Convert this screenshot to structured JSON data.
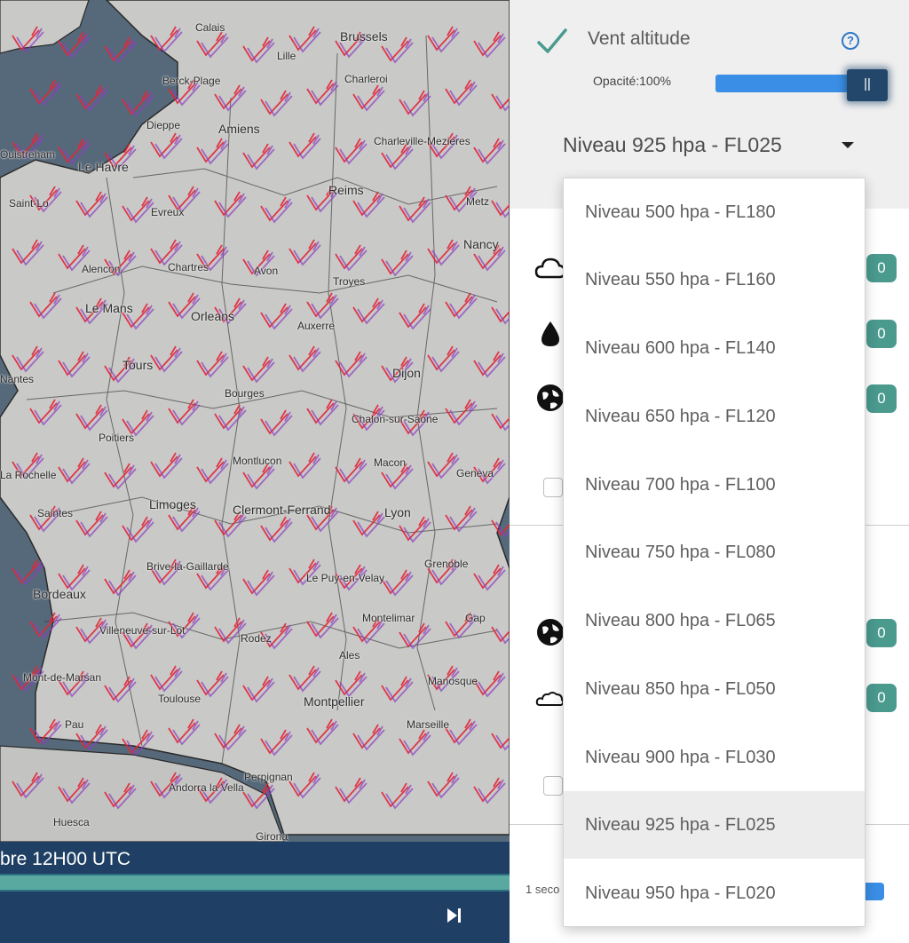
{
  "map": {
    "cities": [
      "Brussels",
      "Charleroi",
      "Calais",
      "Berck-Plage",
      "Lille",
      "Amiens",
      "Dieppe",
      "Le Havre",
      "Charleville-Mezieres",
      "Reims",
      "Evreux",
      "Metz",
      "Nancy",
      "Saint-Lo",
      "Alencon",
      "Chartres",
      "Avon",
      "Troyes",
      "Le Mans",
      "Orleans",
      "Auxerre",
      "Tours",
      "Dijon",
      "Bourges",
      "Chalon-sur-Saone",
      "Poitiers",
      "Montlucon",
      "Macon",
      "Limoges",
      "Clermont-Ferrand",
      "Lyon",
      "Saintes",
      "Geneva",
      "Grenoble",
      "Brive-la-Gaillarde",
      "Le Puy-en-Velay",
      "Bordeaux",
      "Montelimar",
      "Gap",
      "Villeneuve-sur-Lot",
      "Rodez",
      "Ales",
      "Mont-de-Marsan",
      "Manosque",
      "Toulouse",
      "Montpellier",
      "Marseille",
      "Pau",
      "Perpignan",
      "Andorra la Vella",
      "Huesca",
      "Girona",
      "La Rochelle",
      "Nantes",
      "Ouistreham"
    ],
    "time_label": "bre 12H00 UTC",
    "next_icon": "skip-next-icon"
  },
  "panel": {
    "layer_title": "Vent altitude",
    "check_icon": "check-icon",
    "help_icon_glyph": "?",
    "opacity_label": "Opacité:100%",
    "opacity_value": 1.0,
    "handle_glyph": "||",
    "selected_level": "Niveau 925 hpa - FL025",
    "rows": [
      {
        "icon": "cloud-icon",
        "badge": "0"
      },
      {
        "icon": "droplet-icon",
        "badge": "0"
      },
      {
        "icon": "globe-icon",
        "badge": "0"
      },
      {
        "icon": "globe-icon",
        "badge": "0"
      },
      {
        "icon": "cloud-outline-icon",
        "badge": "0"
      }
    ],
    "seconds_label": "1 seco"
  },
  "dropdown": {
    "options": [
      "Niveau 500 hpa - FL180",
      "Niveau 550 hpa - FL160",
      "Niveau 600 hpa - FL140",
      "Niveau 650 hpa - FL120",
      "Niveau 700 hpa - FL100",
      "Niveau 750 hpa - FL080",
      "Niveau 800 hpa - FL065",
      "Niveau 850 hpa - FL050",
      "Niveau 900 hpa - FL030",
      "Niveau 925 hpa - FL025",
      "Niveau 950 hpa - FL020"
    ],
    "selected_index": 9
  },
  "colors": {
    "accent_teal": "#4a9a8e",
    "slider_blue": "#3a8ee6",
    "map_bar": "#1f4064",
    "wind_red": "#e0283c",
    "wind_purple": "#8a3fbf"
  }
}
